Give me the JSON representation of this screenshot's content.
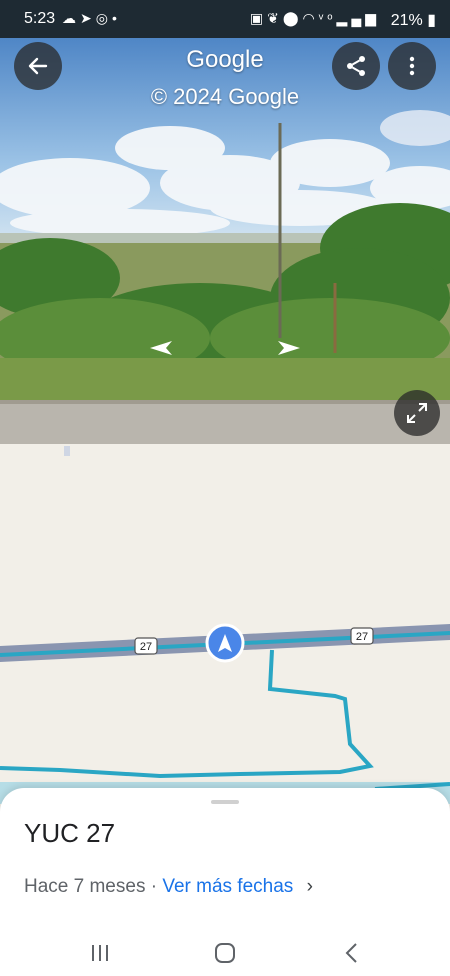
{
  "status_bar": {
    "time": "5:23",
    "battery": "21%",
    "left_icons": [
      "cloud-icon",
      "telegram-icon",
      "nfc-icon",
      "dot-icon"
    ],
    "right_icons": [
      "sim-icon",
      "leaf-icon",
      "location-icon",
      "wifi-icon",
      "volte-icon",
      "signal-icon",
      "battery-icon"
    ]
  },
  "header": {
    "title": "Google",
    "copyright": "© 2024 Google",
    "back_icon": "arrow-left-icon",
    "share_icon": "share-icon",
    "more_icon": "more-vert-icon"
  },
  "map": {
    "road_shields": [
      "27",
      "27"
    ],
    "route_color": "#2aa6c4",
    "road_color": "#8a95b0",
    "pegman_color": "#4a86e8"
  },
  "sheet": {
    "title": "YUC 27",
    "date_text": "Hace 7 meses · ",
    "link_text": "Ver más fechas",
    "chevron": "›"
  },
  "colors": {
    "link": "#1a73e8",
    "status_bg": "#1e2a33"
  }
}
